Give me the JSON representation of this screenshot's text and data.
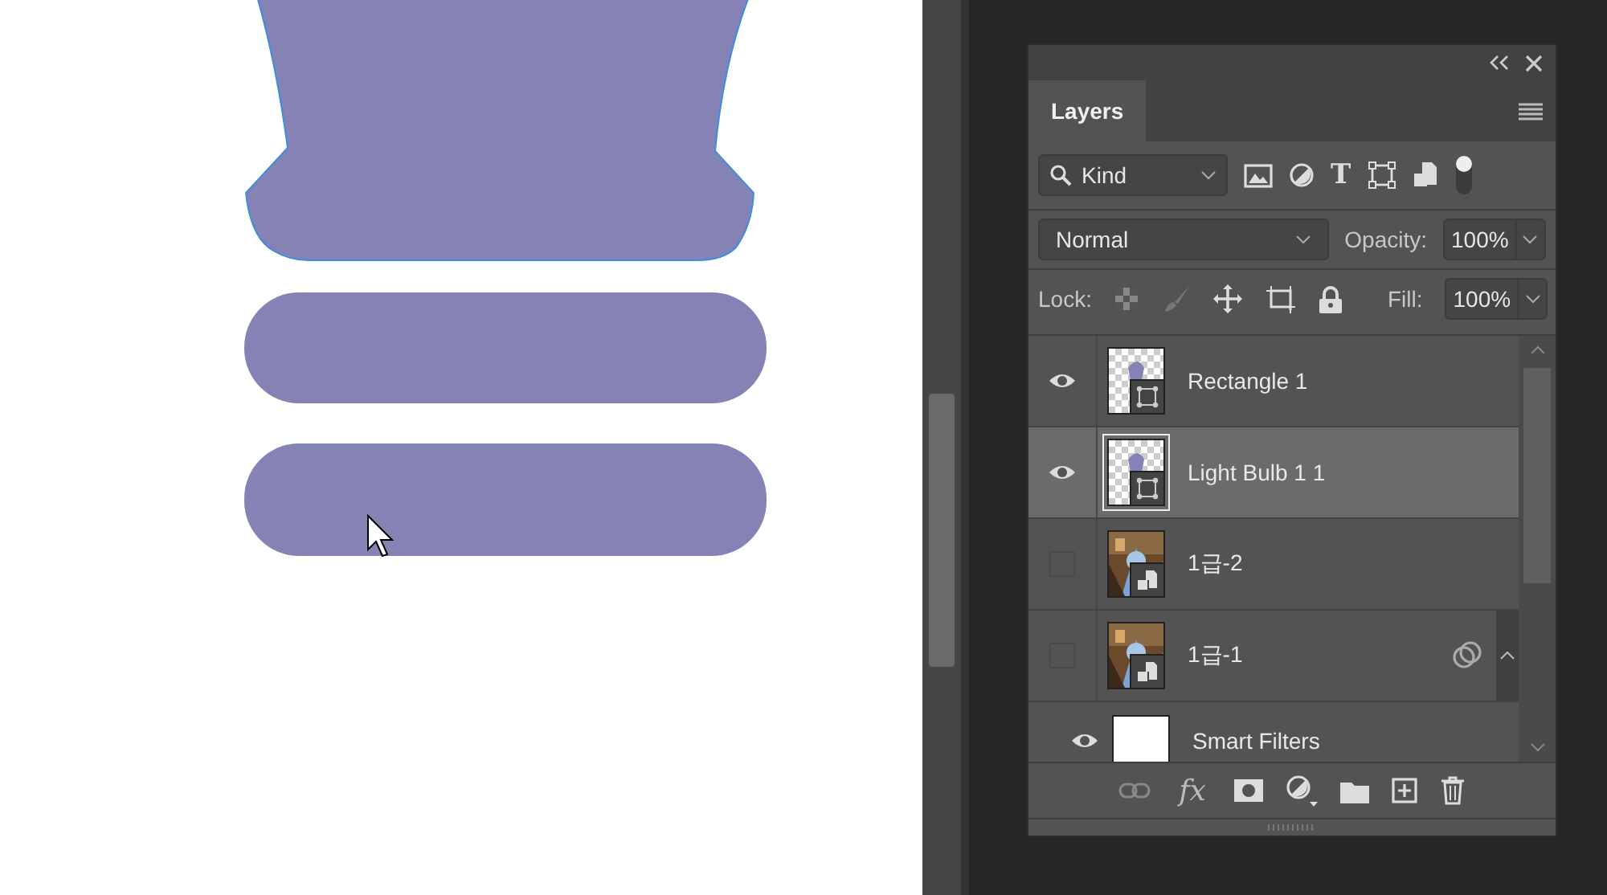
{
  "panel": {
    "tab": "Layers",
    "filter_kind": "Kind",
    "type_filter": "T",
    "blend_mode": "Normal",
    "opacity_label": "Opacity:",
    "opacity": "100%",
    "lock_label": "Lock:",
    "fill_label": "Fill:",
    "fill": "100%",
    "fx_label": "fx"
  },
  "layers": [
    {
      "name": "Rectangle 1",
      "kind": "shape",
      "visible": true,
      "selected": false
    },
    {
      "name": "Light Bulb 1 1",
      "kind": "shape",
      "visible": true,
      "selected": true
    },
    {
      "name": "1급-2",
      "kind": "smart",
      "visible": false,
      "selected": false
    },
    {
      "name": "1급-1",
      "kind": "smart",
      "visible": false,
      "selected": false,
      "has_filters": true,
      "expanded": true,
      "children": [
        {
          "name": "Smart Filters",
          "kind": "filters",
          "visible": true,
          "selected": false
        }
      ]
    }
  ]
}
